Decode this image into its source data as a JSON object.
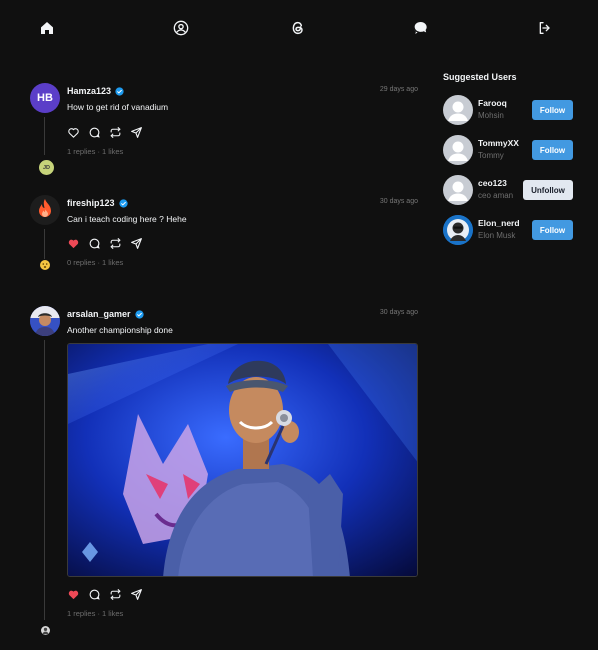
{
  "nav": {
    "home": "home-icon",
    "profile": "profile-icon",
    "threads": "threads-icon",
    "chat": "chat-icon",
    "logout": "logout-icon"
  },
  "posts": [
    {
      "username": "Hamza123",
      "initials": "HB",
      "avatar_color": "#5b3ec8",
      "text": "How to get rid of vanadium",
      "time": "29 days ago",
      "liked": false,
      "replies": "1 replies",
      "likes": "1 likes",
      "replier_initials": "JD"
    },
    {
      "username": "fireship123",
      "text": "Can i teach coding here ? Hehe",
      "time": "30 days ago",
      "liked": true,
      "replies": "0 replies",
      "likes": "1 likes"
    },
    {
      "username": "arsalan_gamer",
      "text": "Another championship done",
      "time": "30 days ago",
      "liked": true,
      "replies": "1 replies",
      "likes": "1 likes"
    }
  ],
  "suggested": {
    "title": "Suggested Users",
    "users": [
      {
        "username": "Farooq",
        "name": "Mohsin",
        "button": "Follow",
        "following": false
      },
      {
        "username": "TommyXX",
        "name": "Tommy",
        "button": "Follow",
        "following": false
      },
      {
        "username": "ceo123",
        "name": "ceo aman",
        "button": "Unfollow",
        "following": true
      },
      {
        "username": "Elon_nerd",
        "name": "Elon Musk",
        "button": "Follow",
        "following": false
      }
    ]
  },
  "colors": {
    "background": "#101010",
    "verified": "#1d9bf0",
    "like": "#ed4956",
    "follow": "#4299e1"
  }
}
